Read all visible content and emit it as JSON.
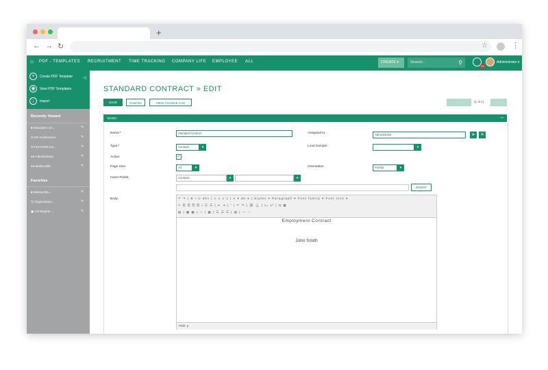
{
  "browser": {
    "new_tab_symbol": "+"
  },
  "nav": {
    "home_icon": "home-icon",
    "items": [
      "PDF - TEMPLATES",
      "RECRUITMENT",
      "TIME TRACKING",
      "COMPANY LIFE",
      "EMPLOYEE",
      "ALL"
    ],
    "create_label": "CREATE",
    "search_placeholder": "Search...",
    "notifications_count": "20",
    "user_label": "Administrator"
  },
  "sidebar": {
    "actions": [
      "Create PDF Template",
      "View PDF Templates",
      "Import"
    ],
    "recent_heading": "Recently Viewed",
    "recent_items": [
      "Standard Con...",
      "HR Conference",
      "FEATURE EX...",
      "Administrator",
      "Melisa Ellis"
    ],
    "favorites_heading": "Favorites",
    "favorite_items": [
      "Melisa Ellis...",
      "Organization...",
      "Christopher ..."
    ]
  },
  "page": {
    "title": "STANDARD CONTRACT » EDIT",
    "buttons": {
      "save": "SAVE",
      "cancel": "CANCEL",
      "view_log": "VIEW CHANGE LOG"
    },
    "pagination": "(1 of 1)"
  },
  "panel": {
    "title": "BASIC",
    "collapse_symbol": "–"
  },
  "form": {
    "name_label": "Name:*",
    "name_value": "Standard Contract",
    "assigned_label": "Assigned to:",
    "assigned_value": "Administrator",
    "type_label": "Type:*",
    "type_value": "Contacts",
    "load_sample_label": "Load Sample:",
    "active_label": "Active:",
    "page_size_label": "Page Size:",
    "page_size_value": "A4",
    "orientation_label": "Orientation:",
    "orientation_value": "Portrait",
    "insert_fields_label": "Insert Fields:",
    "insert_fields_value": "Contacts",
    "insert_button": "INSERT",
    "body_label": "Body:"
  },
  "editor": {
    "toolbar_row1": "↶ ↷ | B I U abc | ≡ ≡ ≡ ≡ | A ▾ ab ▾ | Styles ▾ Paragraph ▾ Font family ▾ Font size ▾",
    "toolbar_row2": "✂ ⎘ ⎘ ⎘ ⎘ | ☰ ☰ | ⇤ ⇥ | ” | ↶ ↷ | ⛓ ⚓ | x₂ x² | Ω ▦",
    "toolbar_row3": "▤ | ▦ ▦ | — | ▦ | ☰ ☰ ☰ | ▤ | — —",
    "doc_title": "Employment Contract",
    "doc_name": "John Smith",
    "path_label": "Path: p"
  }
}
